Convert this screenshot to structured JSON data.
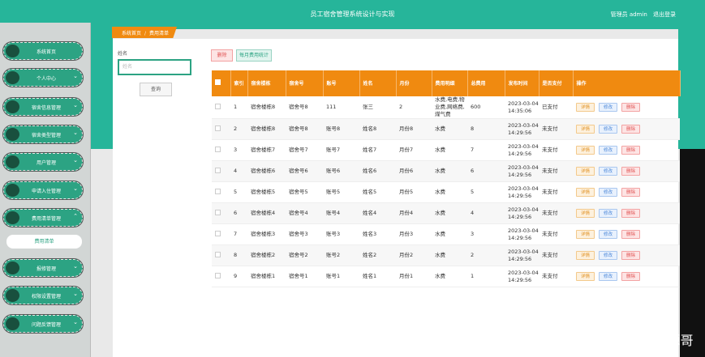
{
  "header": {
    "title": "员工宿舍管理系统设计与实现",
    "user_label": "管理员 admin",
    "logout": "退出登录"
  },
  "sidebar": {
    "items": [
      {
        "label": "系统首页",
        "has_chevron": false
      },
      {
        "label": "个人中心",
        "has_chevron": true
      },
      {
        "label": "宿舍信息管理",
        "has_chevron": true
      },
      {
        "label": "宿舍类型管理",
        "has_chevron": true
      },
      {
        "label": "用户管理",
        "has_chevron": true
      },
      {
        "label": "申请入住管理",
        "has_chevron": true
      },
      {
        "label": "费用清单管理",
        "has_chevron": true,
        "expanded": true
      },
      {
        "label": "费用清单",
        "sub": true
      },
      {
        "label": "报修管理",
        "has_chevron": true
      },
      {
        "label": "权限设置管理",
        "has_chevron": true
      },
      {
        "label": "问题反馈管理",
        "has_chevron": true
      }
    ]
  },
  "breadcrumb": {
    "home": "系统首页",
    "separator": "/",
    "current": "费用清单"
  },
  "search": {
    "label": "姓名",
    "placeholder": "姓名",
    "button": "查询"
  },
  "toolbar": {
    "delete": "删除",
    "stats": "每月费用统计"
  },
  "table": {
    "headers": [
      "索引",
      "宿舍楼栋",
      "宿舍号",
      "账号",
      "姓名",
      "月份",
      "费用明细",
      "总费用",
      "发布时间",
      "是否支付",
      "操作"
    ],
    "actions": {
      "detail": "详情",
      "edit": "修改",
      "delete": "删除"
    },
    "rows": [
      {
        "idx": "1",
        "building": "宿舍楼栋8",
        "room": "宿舍号8",
        "account": "111",
        "name": "张三",
        "month": "2",
        "detail": "水费,电费,物业费,网络费,煤气费",
        "total": "600",
        "time": "2023-03-04 14:35:06",
        "paid": "已支付"
      },
      {
        "idx": "2",
        "building": "宿舍楼栋8",
        "room": "宿舍号8",
        "account": "账号8",
        "name": "姓名8",
        "month": "月份8",
        "detail": "水费",
        "total": "8",
        "time": "2023-03-04 14:29:56",
        "paid": "未支付"
      },
      {
        "idx": "3",
        "building": "宿舍楼栋7",
        "room": "宿舍号7",
        "account": "账号7",
        "name": "姓名7",
        "month": "月份7",
        "detail": "水费",
        "total": "7",
        "time": "2023-03-04 14:29:56",
        "paid": "未支付"
      },
      {
        "idx": "4",
        "building": "宿舍楼栋6",
        "room": "宿舍号6",
        "account": "账号6",
        "name": "姓名6",
        "month": "月份6",
        "detail": "水费",
        "total": "6",
        "time": "2023-03-04 14:29:56",
        "paid": "未支付"
      },
      {
        "idx": "5",
        "building": "宿舍楼栋5",
        "room": "宿舍号5",
        "account": "账号5",
        "name": "姓名5",
        "month": "月份5",
        "detail": "水费",
        "total": "5",
        "time": "2023-03-04 14:29:56",
        "paid": "未支付"
      },
      {
        "idx": "6",
        "building": "宿舍楼栋4",
        "room": "宿舍号4",
        "account": "账号4",
        "name": "姓名4",
        "month": "月份4",
        "detail": "水费",
        "total": "4",
        "time": "2023-03-04 14:29:56",
        "paid": "未支付"
      },
      {
        "idx": "7",
        "building": "宿舍楼栋3",
        "room": "宿舍号3",
        "account": "账号3",
        "name": "姓名3",
        "month": "月份3",
        "detail": "水费",
        "total": "3",
        "time": "2023-03-04 14:29:56",
        "paid": "未支付"
      },
      {
        "idx": "8",
        "building": "宿舍楼栋2",
        "room": "宿舍号2",
        "account": "账号2",
        "name": "姓名2",
        "month": "月份2",
        "detail": "水费",
        "total": "2",
        "time": "2023-03-04 14:29:56",
        "paid": "未支付"
      },
      {
        "idx": "9",
        "building": "宿舍楼栋1",
        "room": "宿舍号1",
        "account": "账号1",
        "name": "姓名1",
        "month": "月份1",
        "detail": "水费",
        "total": "1",
        "time": "2023-03-04 14:29:56",
        "paid": "未支付"
      }
    ]
  },
  "watermark": "CSDN @计算机程序设计源哥",
  "colors": {
    "primary": "#2ca383",
    "header": "#26b59a",
    "accent": "#f08a10"
  }
}
